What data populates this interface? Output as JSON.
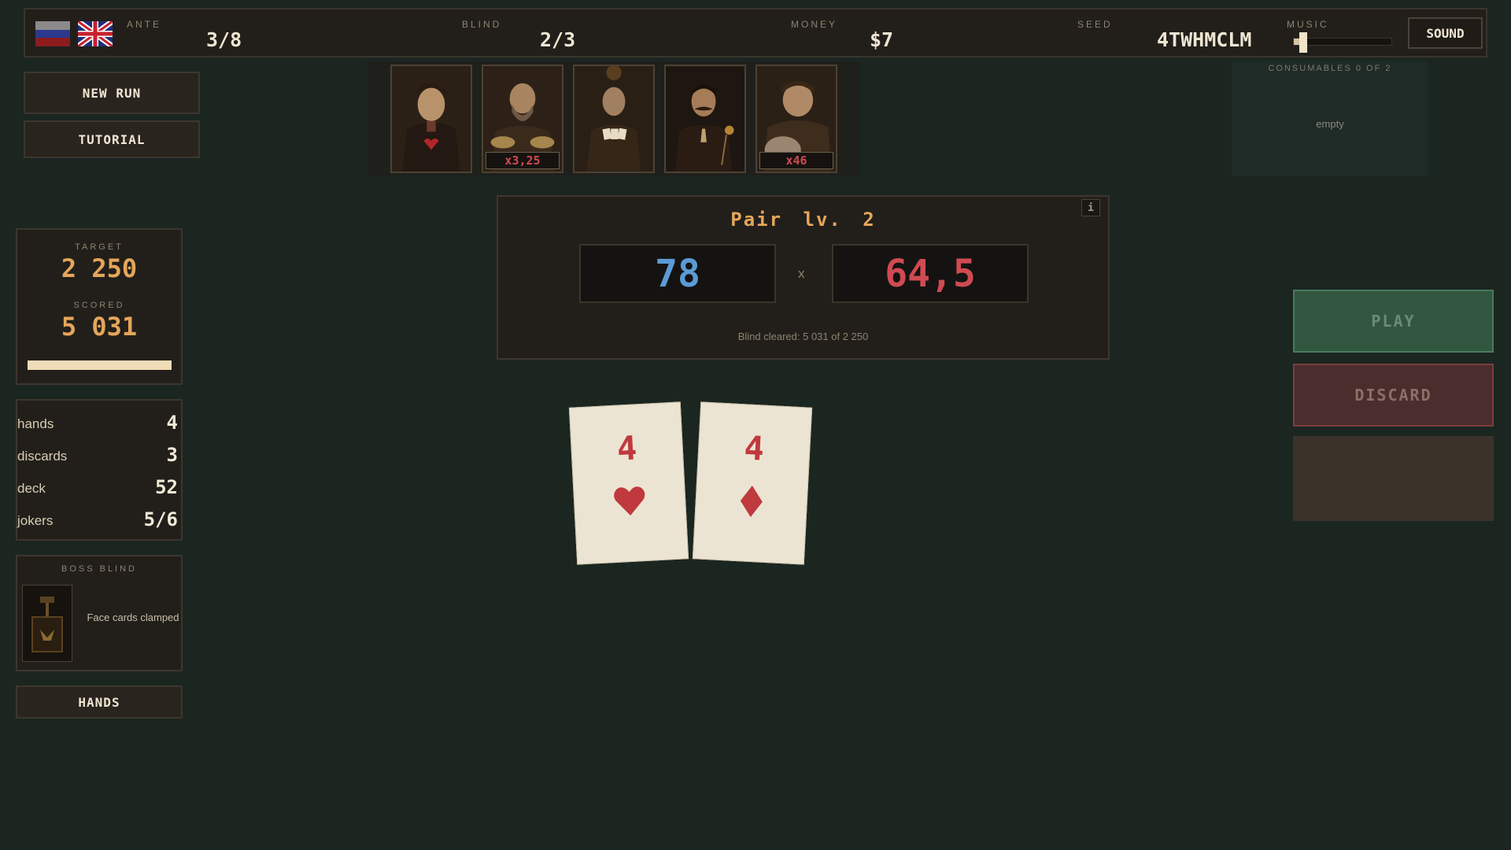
{
  "topbar": {
    "flags": [
      "flag-ru-icon",
      "flag-gb-icon"
    ],
    "ante": {
      "label": "ANTE",
      "value": "3/8"
    },
    "blind": {
      "label": "BLIND",
      "value": "2/3"
    },
    "money": {
      "label": "MONEY",
      "value": "$7"
    },
    "seed": {
      "label": "SEED",
      "value": "4TWHMCLM"
    },
    "music": {
      "label": "MUSIC",
      "level": 0.1
    },
    "sound_label": "SOUND"
  },
  "menu": {
    "new_run": "NEW RUN",
    "tutorial": "TUTORIAL",
    "hands": "HANDS"
  },
  "jokers": [
    {
      "name": "joker-1",
      "badge": ""
    },
    {
      "name": "joker-2",
      "badge": "x3,25"
    },
    {
      "name": "joker-3",
      "badge": ""
    },
    {
      "name": "joker-4",
      "badge": ""
    },
    {
      "name": "joker-5",
      "badge": "x46"
    }
  ],
  "consumables": {
    "label": "CONSUMABLES 0 OF 2",
    "empty_text": "empty"
  },
  "score": {
    "target_label": "TARGET",
    "target_value": "2 250",
    "scored_label": "SCORED",
    "scored_value": "5 031",
    "progress": 1.0
  },
  "resources": [
    {
      "name": "hands",
      "value": "4"
    },
    {
      "name": "discards",
      "value": "3"
    },
    {
      "name": "deck",
      "value": "52"
    },
    {
      "name": "jokers",
      "value": "5/6"
    }
  ],
  "boss_blind": {
    "label": "BOSS BLIND",
    "description": "Face cards clamped"
  },
  "hand_info": {
    "title": "Pair lv. 2",
    "info_label": "i",
    "chips": "78",
    "times": "x",
    "mult": "64,5",
    "cleared_text": "Blind cleared: 5 031 of 2 250"
  },
  "played_cards": [
    {
      "rank": "4",
      "suit": "heart-icon"
    },
    {
      "rank": "4",
      "suit": "diamond-icon"
    }
  ],
  "actions": {
    "play": "PLAY",
    "discard": "DISCARD"
  },
  "colors": {
    "background": "#1b2621",
    "chips": "#5b9bd5",
    "mult": "#d04a52",
    "gold": "#e5a65a"
  }
}
